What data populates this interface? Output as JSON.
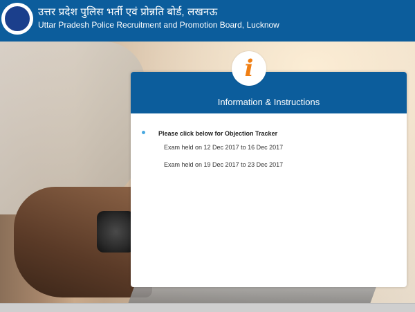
{
  "header": {
    "hindi_title": "उत्तर प्रदेश पुलिस भर्ती एवं प्रोन्नति बोर्ड, लखनऊ",
    "english_title": "Uttar Pradesh Police Recruitment and Promotion Board, Lucknow",
    "logo_icon": "up-police-emblem-icon",
    "background_color": "#0c5d9c"
  },
  "panel": {
    "icon": "info-icon",
    "icon_glyph": "i",
    "icon_color": "#f07f14",
    "title": "Information & Instructions",
    "notice": "Please click below for Objection Tracker",
    "links": [
      {
        "label": "Exam held on 12 Dec 2017 to 16 Dec 2017"
      },
      {
        "label": "Exam held on 19 Dec 2017 to 23 Dec 2017"
      }
    ]
  }
}
